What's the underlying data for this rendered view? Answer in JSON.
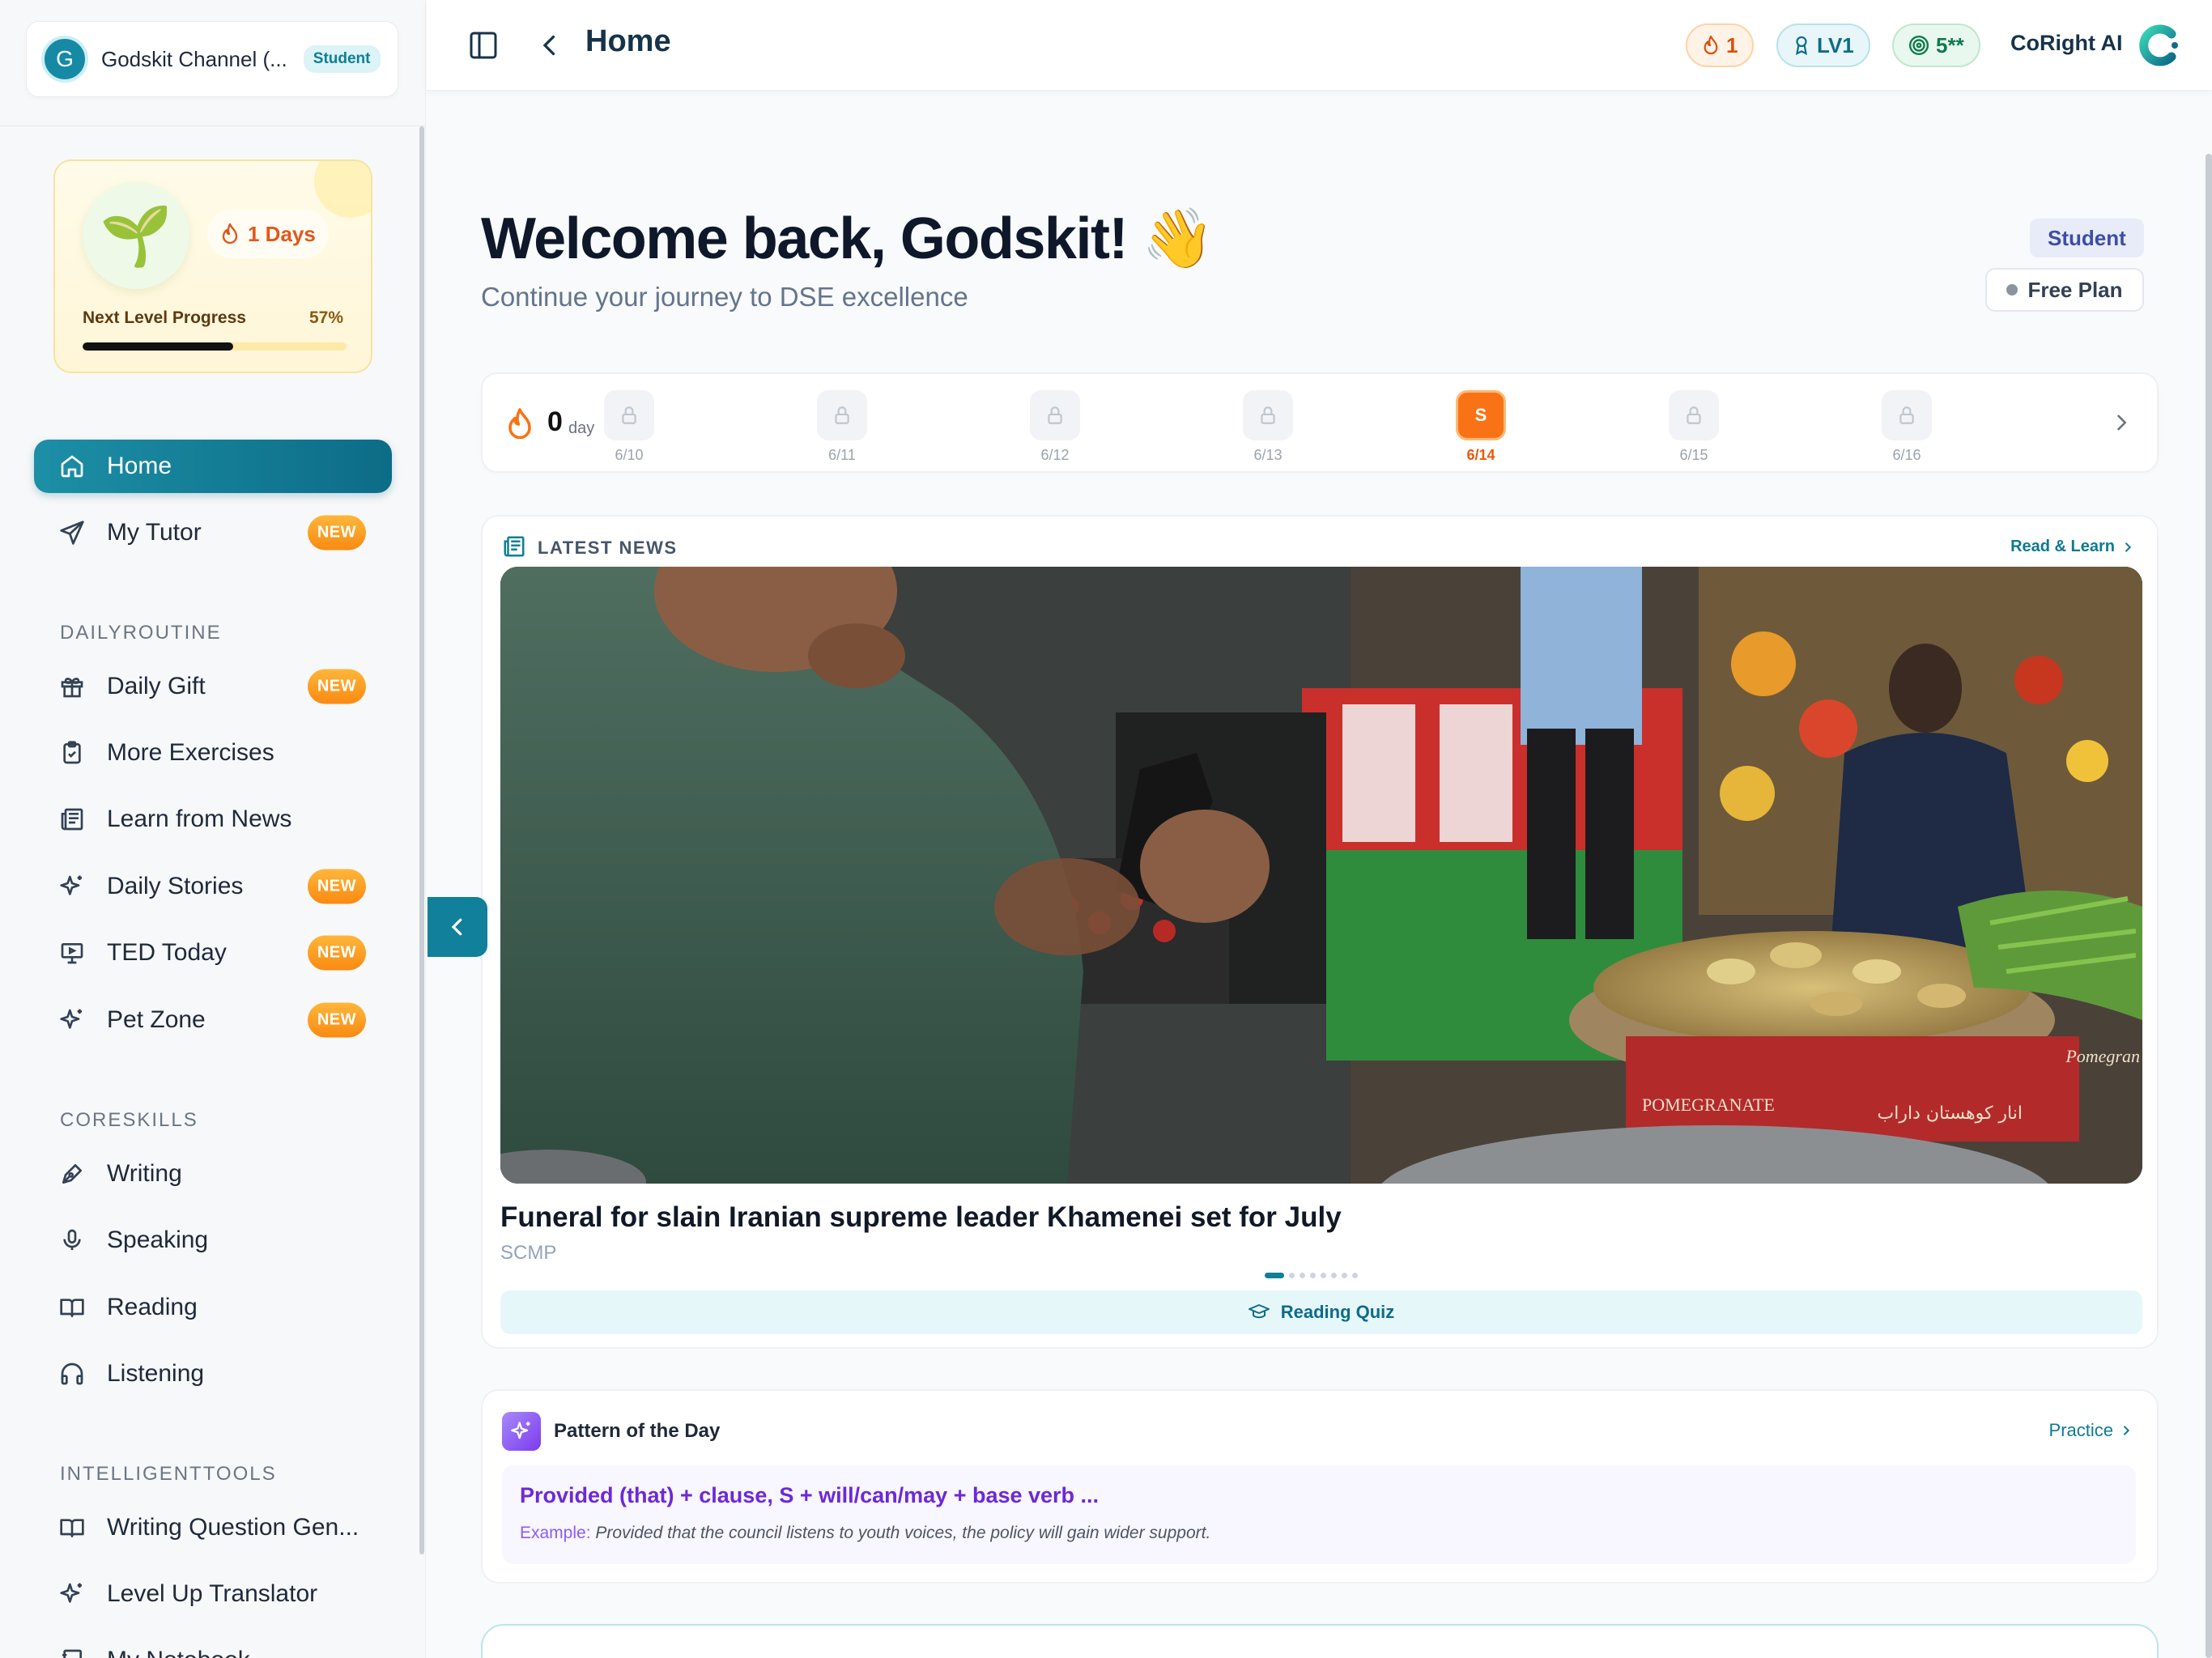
{
  "sidebar": {
    "profile": {
      "initial": "G",
      "name": "Godskit Channel (...",
      "role": "Student"
    },
    "streak_card": {
      "days": "1 Days",
      "progress_label": "Next Level Progress",
      "progress_pct": "57%",
      "progress_value": 0.57
    },
    "nav_main": [
      {
        "label": "Home",
        "icon": "home-icon",
        "active": true
      },
      {
        "label": "My Tutor",
        "icon": "send-icon",
        "badge": "NEW"
      }
    ],
    "section_daily": "DAILYROUTINE",
    "nav_daily": [
      {
        "label": "Daily Gift",
        "icon": "gift-icon",
        "badge": "NEW"
      },
      {
        "label": "More Exercises",
        "icon": "clipboard-icon"
      },
      {
        "label": "Learn from News",
        "icon": "newspaper-icon"
      },
      {
        "label": "Daily Stories",
        "icon": "sparkles-icon",
        "badge": "NEW"
      },
      {
        "label": "TED Today",
        "icon": "presentation-icon",
        "badge": "NEW"
      },
      {
        "label": "Pet Zone",
        "icon": "sparkles-icon",
        "badge": "NEW"
      }
    ],
    "section_core": "CORESKILLS",
    "nav_core": [
      {
        "label": "Writing",
        "icon": "pen-icon"
      },
      {
        "label": "Speaking",
        "icon": "microphone-icon"
      },
      {
        "label": "Reading",
        "icon": "book-open-icon"
      },
      {
        "label": "Listening",
        "icon": "headphones-icon"
      }
    ],
    "section_tools": "INTELLIGENTTOOLS",
    "nav_tools": [
      {
        "label": "Writing Question Gen...",
        "icon": "book-open-icon"
      },
      {
        "label": "Level Up Translator",
        "icon": "sparkles-icon"
      },
      {
        "label": "My Notebook",
        "icon": "notebook-icon"
      }
    ]
  },
  "header": {
    "title": "Home",
    "streak_pill": "1",
    "level_pill": "LV1",
    "score_pill": "5**",
    "brand": "CoRight AI"
  },
  "welcome": {
    "title": "Welcome back, Godskit! 👋",
    "subtitle": "Continue your journey to DSE excellence",
    "role_chip": "Student",
    "plan_chip": "Free Plan"
  },
  "streak_row": {
    "count": "0",
    "unit": "day",
    "days": [
      {
        "label": "6/10",
        "state": "locked"
      },
      {
        "label": "6/11",
        "state": "locked"
      },
      {
        "label": "6/12",
        "state": "locked"
      },
      {
        "label": "6/13",
        "state": "locked"
      },
      {
        "label": "6/14",
        "state": "today",
        "mark": "S"
      },
      {
        "label": "6/15",
        "state": "locked"
      },
      {
        "label": "6/16",
        "state": "locked"
      }
    ]
  },
  "news": {
    "section": "LATEST NEWS",
    "link": "Read & Learn",
    "headline": "Funeral for slain Iranian supreme leader Khamenei set for July",
    "source": "SCMP",
    "slide_count": 8,
    "active_slide": 1,
    "quiz_label": "Reading Quiz",
    "photo_signs": {
      "left": "POMEGRANATE",
      "right": "انار کوهستان داراب",
      "edge": "Pomegran"
    }
  },
  "pattern": {
    "title": "Pattern of the Day",
    "link": "Practice",
    "formula": "Provided (that) + clause, S + will/can/may + base verb ...",
    "example_label": "Example:",
    "example_text": "Provided that the council listens to youth voices, the policy will gain wider support."
  },
  "colors": {
    "primary": "#0e7f95",
    "accent_orange": "#f97316",
    "purple": "#6d28d9"
  }
}
